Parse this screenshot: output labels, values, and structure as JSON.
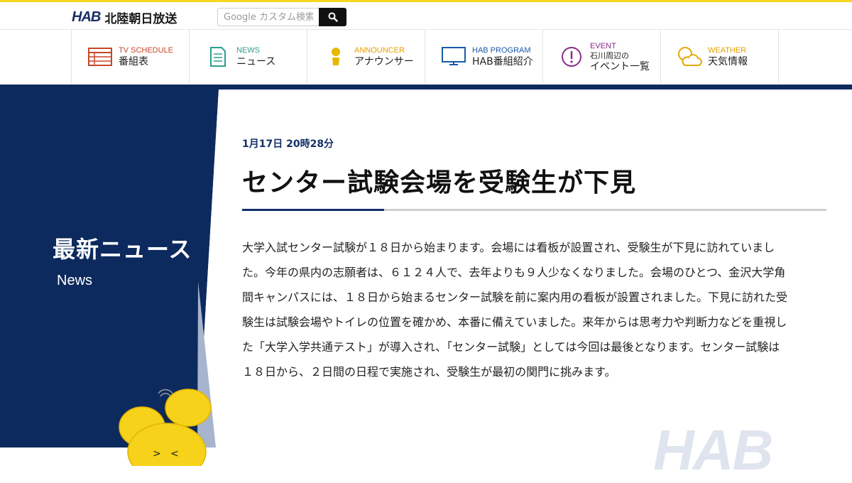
{
  "header": {
    "logo_mark": "HAB",
    "logo_name": "北陸朝日放送",
    "search_placeholder": "Google カスタム検索"
  },
  "nav": [
    {
      "en": "TV SCHEDULE",
      "ja": "番組表",
      "icon": "schedule-grid-icon",
      "color": "#c8472a"
    },
    {
      "en": "NEWS",
      "ja": "ニュース",
      "icon": "document-icon",
      "color": "#2a9d8f"
    },
    {
      "en": "ANNOUNCER",
      "ja": "アナウンサー",
      "icon": "person-icon",
      "color": "#e6b800"
    },
    {
      "en": "HAB PROGRAM",
      "ja": "HAB番組紹介",
      "icon": "monitor-icon",
      "color": "#1a5aa8"
    },
    {
      "en": "EVENT",
      "ja1": "石川周辺の",
      "ja2": "イベント一覧",
      "icon": "exclamation-circle-icon",
      "color": "#8a2a8a"
    },
    {
      "en": "WEATHER",
      "ja": "天気情報",
      "icon": "sun-cloud-icon",
      "color": "#e6a800"
    }
  ],
  "sidebar": {
    "title": "最新ニュース",
    "subtitle": "News"
  },
  "article": {
    "date": "1月17日 20時28分",
    "title": "センター試験会場を受験生が下見",
    "body": "大学入試センター試験が１８日から始まります。会場には看板が設置され、受験生が下見に訪れていました。今年の県内の志願者は、６１２４人で、去年よりも９人少なくなりました。会場のひとつ、金沢大学角間キャンパスには、１８日から始まるセンター試験を前に案内用の看板が設置されました。下見に訪れた受験生は試験会場やトイレの位置を確かめ、本番に備えていました。来年からは思考力や判断力などを重視した「大学入学共通テスト」が導入され、「センター試験」としては今回は最後となります。センター試験は１８日から、２日間の日程で実施され、受験生が最初の関門に挑みます。"
  },
  "watermark": "HAB",
  "colors": {
    "brand_navy": "#0d2a5e",
    "accent_yellow": "#f4d71e"
  }
}
